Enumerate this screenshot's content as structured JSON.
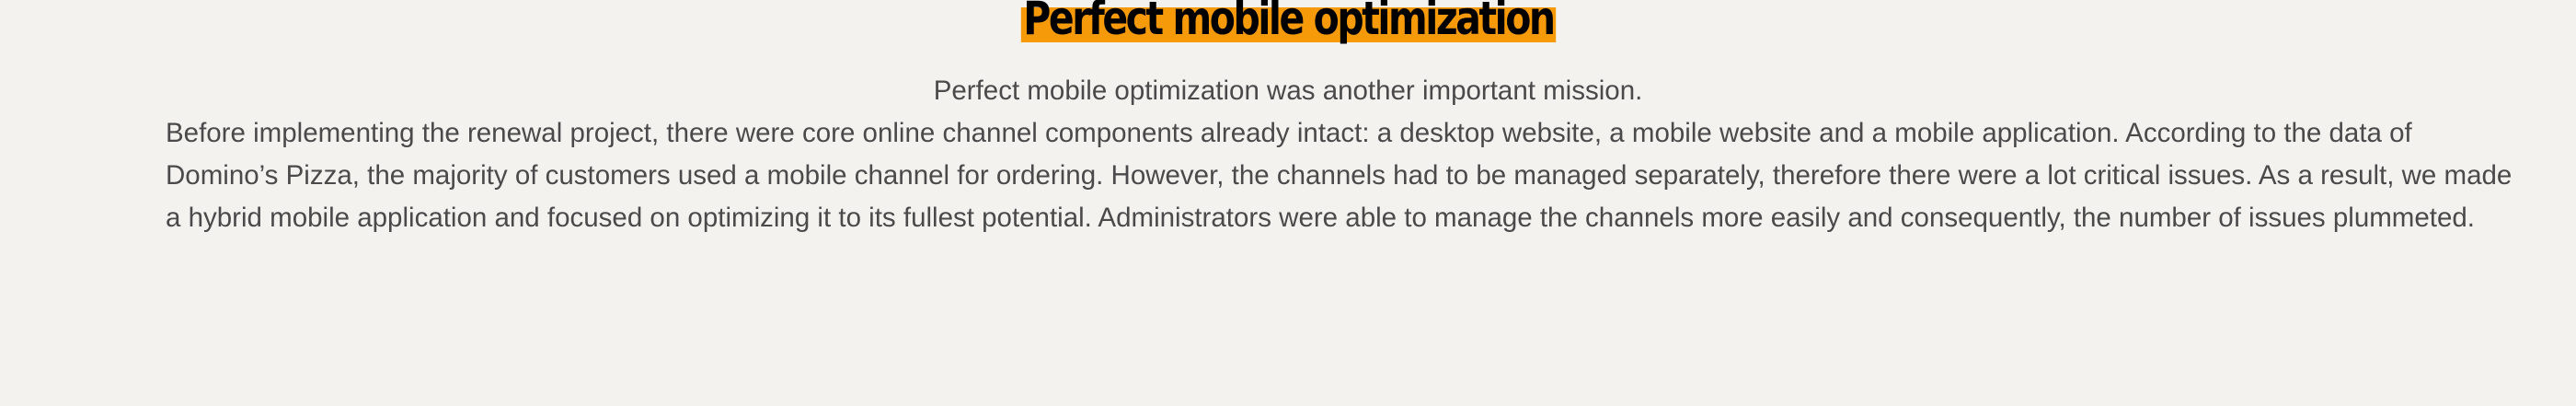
{
  "section": {
    "title": "Perfect mobile optimization",
    "lines": [
      "Perfect mobile optimization was another important mission.",
      "Before implementing the renewal project, there were core online channel components already intact:  a desktop website, a mobile website and a mobile application. According to the data of",
      "Domino’s Pizza, the majority of customers used a mobile channel for ordering. However, the channels had to be managed separately, therefore there were a lot critical issues. As a result, we made",
      "a hybrid mobile application and focused on optimizing it to its fullest potential. Administrators were able to manage the channels more easily and consequently, the number of issues plummeted."
    ]
  },
  "colors": {
    "background": "#f3f2ef",
    "highlight": "#f79a0a",
    "title_text": "#000000",
    "body_text": "#4a4a4a"
  }
}
